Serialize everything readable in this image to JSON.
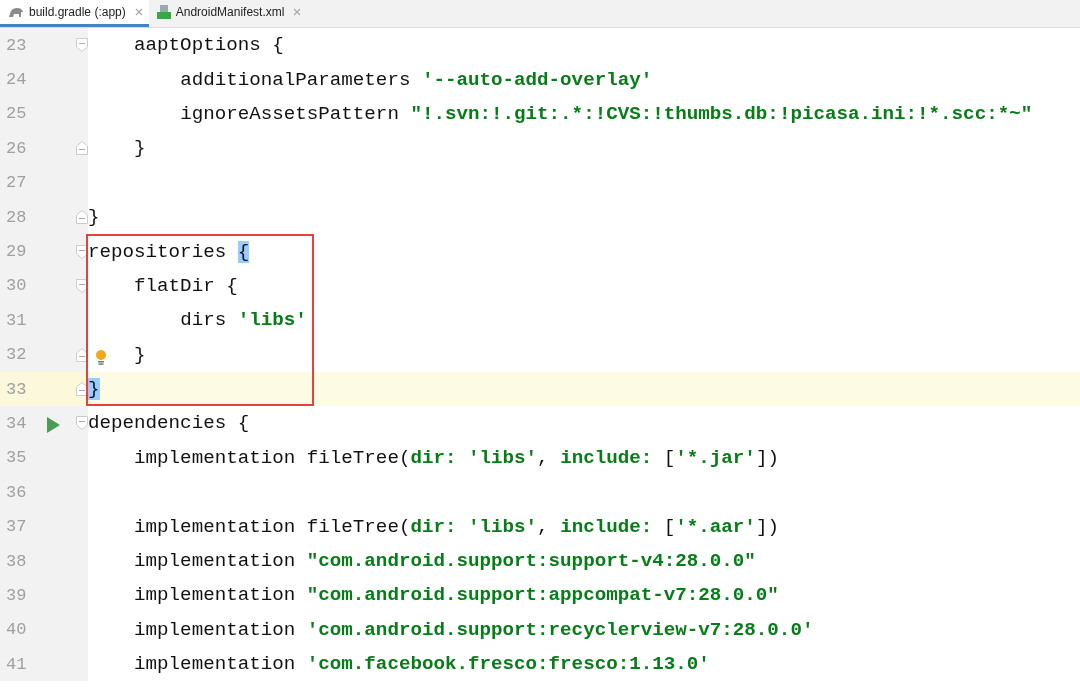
{
  "tabs": [
    {
      "label": "build.gradle (:app)",
      "selected": true
    },
    {
      "label": "AndroidManifest.xml",
      "selected": false
    }
  ],
  "lines": [
    {
      "number": "23",
      "kind": "open",
      "tokens": [
        {
          "kind": "plain",
          "text": "    aaptOptions {"
        }
      ]
    },
    {
      "number": "24",
      "tokens": [
        {
          "kind": "plain",
          "text": "        additionalParameters "
        },
        {
          "kind": "string",
          "text": "'--auto-add-overlay'"
        }
      ]
    },
    {
      "number": "25",
      "tokens": [
        {
          "kind": "plain",
          "text": "        ignoreAssetsPattern "
        },
        {
          "kind": "string",
          "text": "\"!.svn:!.git:.*:!CVS:!thumbs.db:!picasa.ini:!*.scc:*~\""
        }
      ]
    },
    {
      "number": "26",
      "kind": "close",
      "tokens": [
        {
          "kind": "plain",
          "text": "    }"
        }
      ]
    },
    {
      "number": "27",
      "kind": "plain"
    },
    {
      "number": "28",
      "kind": "close",
      "tokens": [
        {
          "kind": "plain",
          "text": "}"
        }
      ]
    },
    {
      "number": "29",
      "kind": "open",
      "boxed": true,
      "tokens": [
        {
          "kind": "plain",
          "text": "repositories "
        },
        {
          "kind": "brace-match",
          "text": "{"
        }
      ]
    },
    {
      "number": "30",
      "kind": "open",
      "boxed": true,
      "tokens": [
        {
          "kind": "plain",
          "text": "    flatDir {"
        }
      ]
    },
    {
      "number": "31",
      "boxed": true,
      "tokens": [
        {
          "kind": "plain",
          "text": "        dirs "
        },
        {
          "kind": "string",
          "text": "'libs'"
        }
      ]
    },
    {
      "number": "32",
      "kind": "hint",
      "boxed": true,
      "tokens": [
        {
          "kind": "plain",
          "text": "    }"
        }
      ]
    },
    {
      "number": "33",
      "kind": "close",
      "boxed": true,
      "current": true,
      "tokens": [
        {
          "kind": "brace-match",
          "text": "}"
        }
      ]
    },
    {
      "number": "34",
      "kind": "run",
      "tokens": [
        {
          "kind": "plain",
          "text": "dependencies {"
        }
      ]
    },
    {
      "number": "35",
      "tokens": [
        {
          "kind": "plain",
          "text": "    implementation fileTree("
        },
        {
          "kind": "named-arg",
          "text": "dir: "
        },
        {
          "kind": "string",
          "text": "'libs'"
        },
        {
          "kind": "plain",
          "text": ", "
        },
        {
          "kind": "named-arg",
          "text": "include: "
        },
        {
          "kind": "plain",
          "text": "["
        },
        {
          "kind": "string",
          "text": "'*.jar'"
        },
        {
          "kind": "plain",
          "text": "])"
        }
      ]
    },
    {
      "number": "36",
      "kind": "plain"
    },
    {
      "number": "37",
      "tokens": [
        {
          "kind": "plain",
          "text": "    implementation fileTree("
        },
        {
          "kind": "named-arg",
          "text": "dir: "
        },
        {
          "kind": "string",
          "text": "'libs'"
        },
        {
          "kind": "plain",
          "text": ", "
        },
        {
          "kind": "named-arg",
          "text": "include: "
        },
        {
          "kind": "plain",
          "text": "["
        },
        {
          "kind": "string",
          "text": "'*.aar'"
        },
        {
          "kind": "plain",
          "text": "])"
        }
      ]
    },
    {
      "number": "38",
      "tokens": [
        {
          "kind": "plain",
          "text": "    implementation "
        },
        {
          "kind": "string",
          "text": "\"com.android.support:support-v4:28.0.0\""
        }
      ]
    },
    {
      "number": "39",
      "tokens": [
        {
          "kind": "plain",
          "text": "    implementation "
        },
        {
          "kind": "string",
          "text": "\"com.android.support:appcompat-v7:28.0.0\""
        }
      ]
    },
    {
      "number": "40",
      "tokens": [
        {
          "kind": "plain",
          "text": "    implementation "
        },
        {
          "kind": "string",
          "text": "'com.android.support:recyclerview-v7:28.0.0'"
        }
      ]
    },
    {
      "number": "41",
      "tokens": [
        {
          "kind": "plain",
          "text": "    implementation "
        },
        {
          "kind": "string",
          "text": "'com.facebook.fresco:fresco:1.13.0'"
        }
      ]
    }
  ]
}
